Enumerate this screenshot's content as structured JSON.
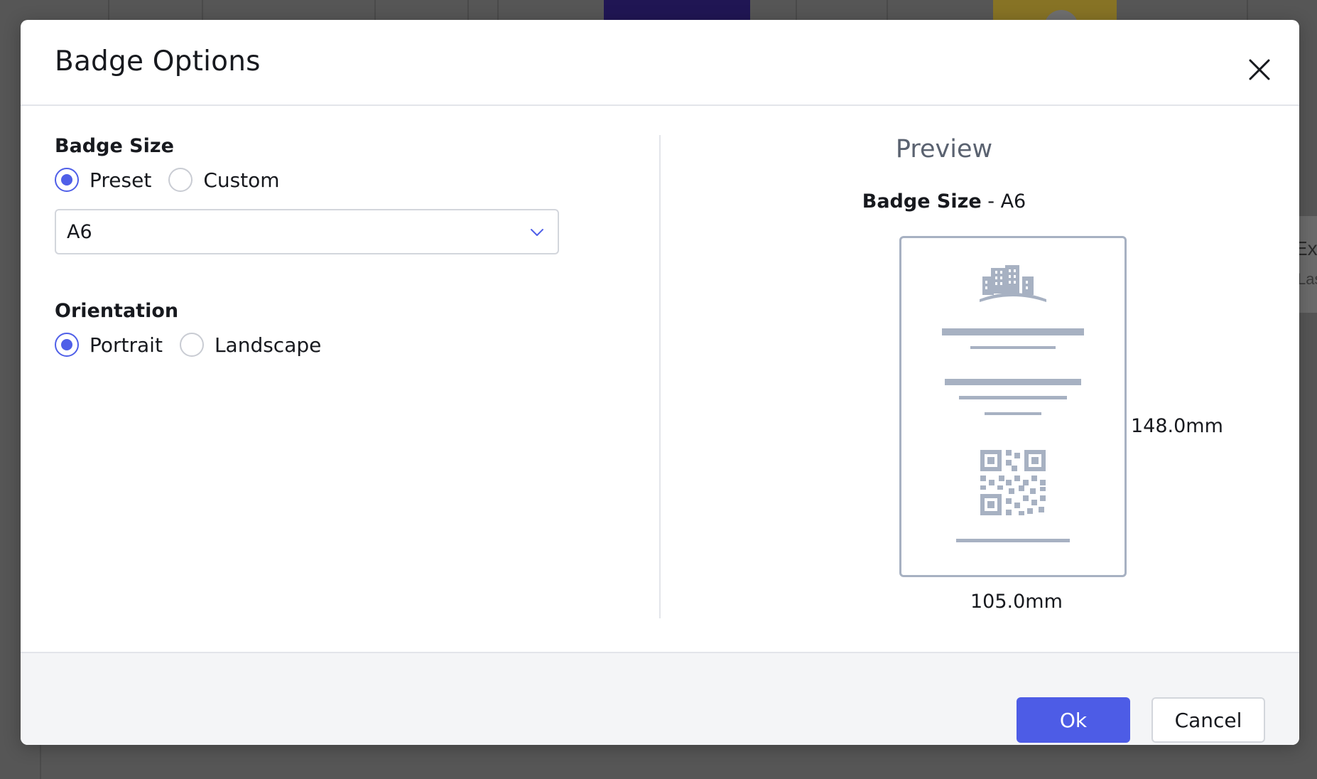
{
  "background": {
    "right_card_title": "Ex",
    "right_card_sub": "Las"
  },
  "modal": {
    "title": "Badge Options",
    "badge_size": {
      "label": "Badge Size",
      "options": [
        "Preset",
        "Custom"
      ],
      "selected": "Preset",
      "preset_value": "A6"
    },
    "orientation": {
      "label": "Orientation",
      "options": [
        "Portrait",
        "Landscape"
      ],
      "selected": "Portrait"
    },
    "preview": {
      "title": "Preview",
      "size_label": "Badge Size",
      "size_sep": " - ",
      "size_value": "A6",
      "height_label": "148.0mm",
      "width_label": "105.0mm"
    },
    "footer": {
      "ok_label": "Ok",
      "cancel_label": "Cancel"
    }
  },
  "colors": {
    "accent": "#4d5ce6",
    "radio_checked": "#4f5fe8",
    "placeholder_art": "#a7b1c2",
    "overlay": "#565656"
  },
  "icons": [
    "close-icon",
    "chevron-down-icon",
    "building-icon",
    "qr-code-icon"
  ]
}
